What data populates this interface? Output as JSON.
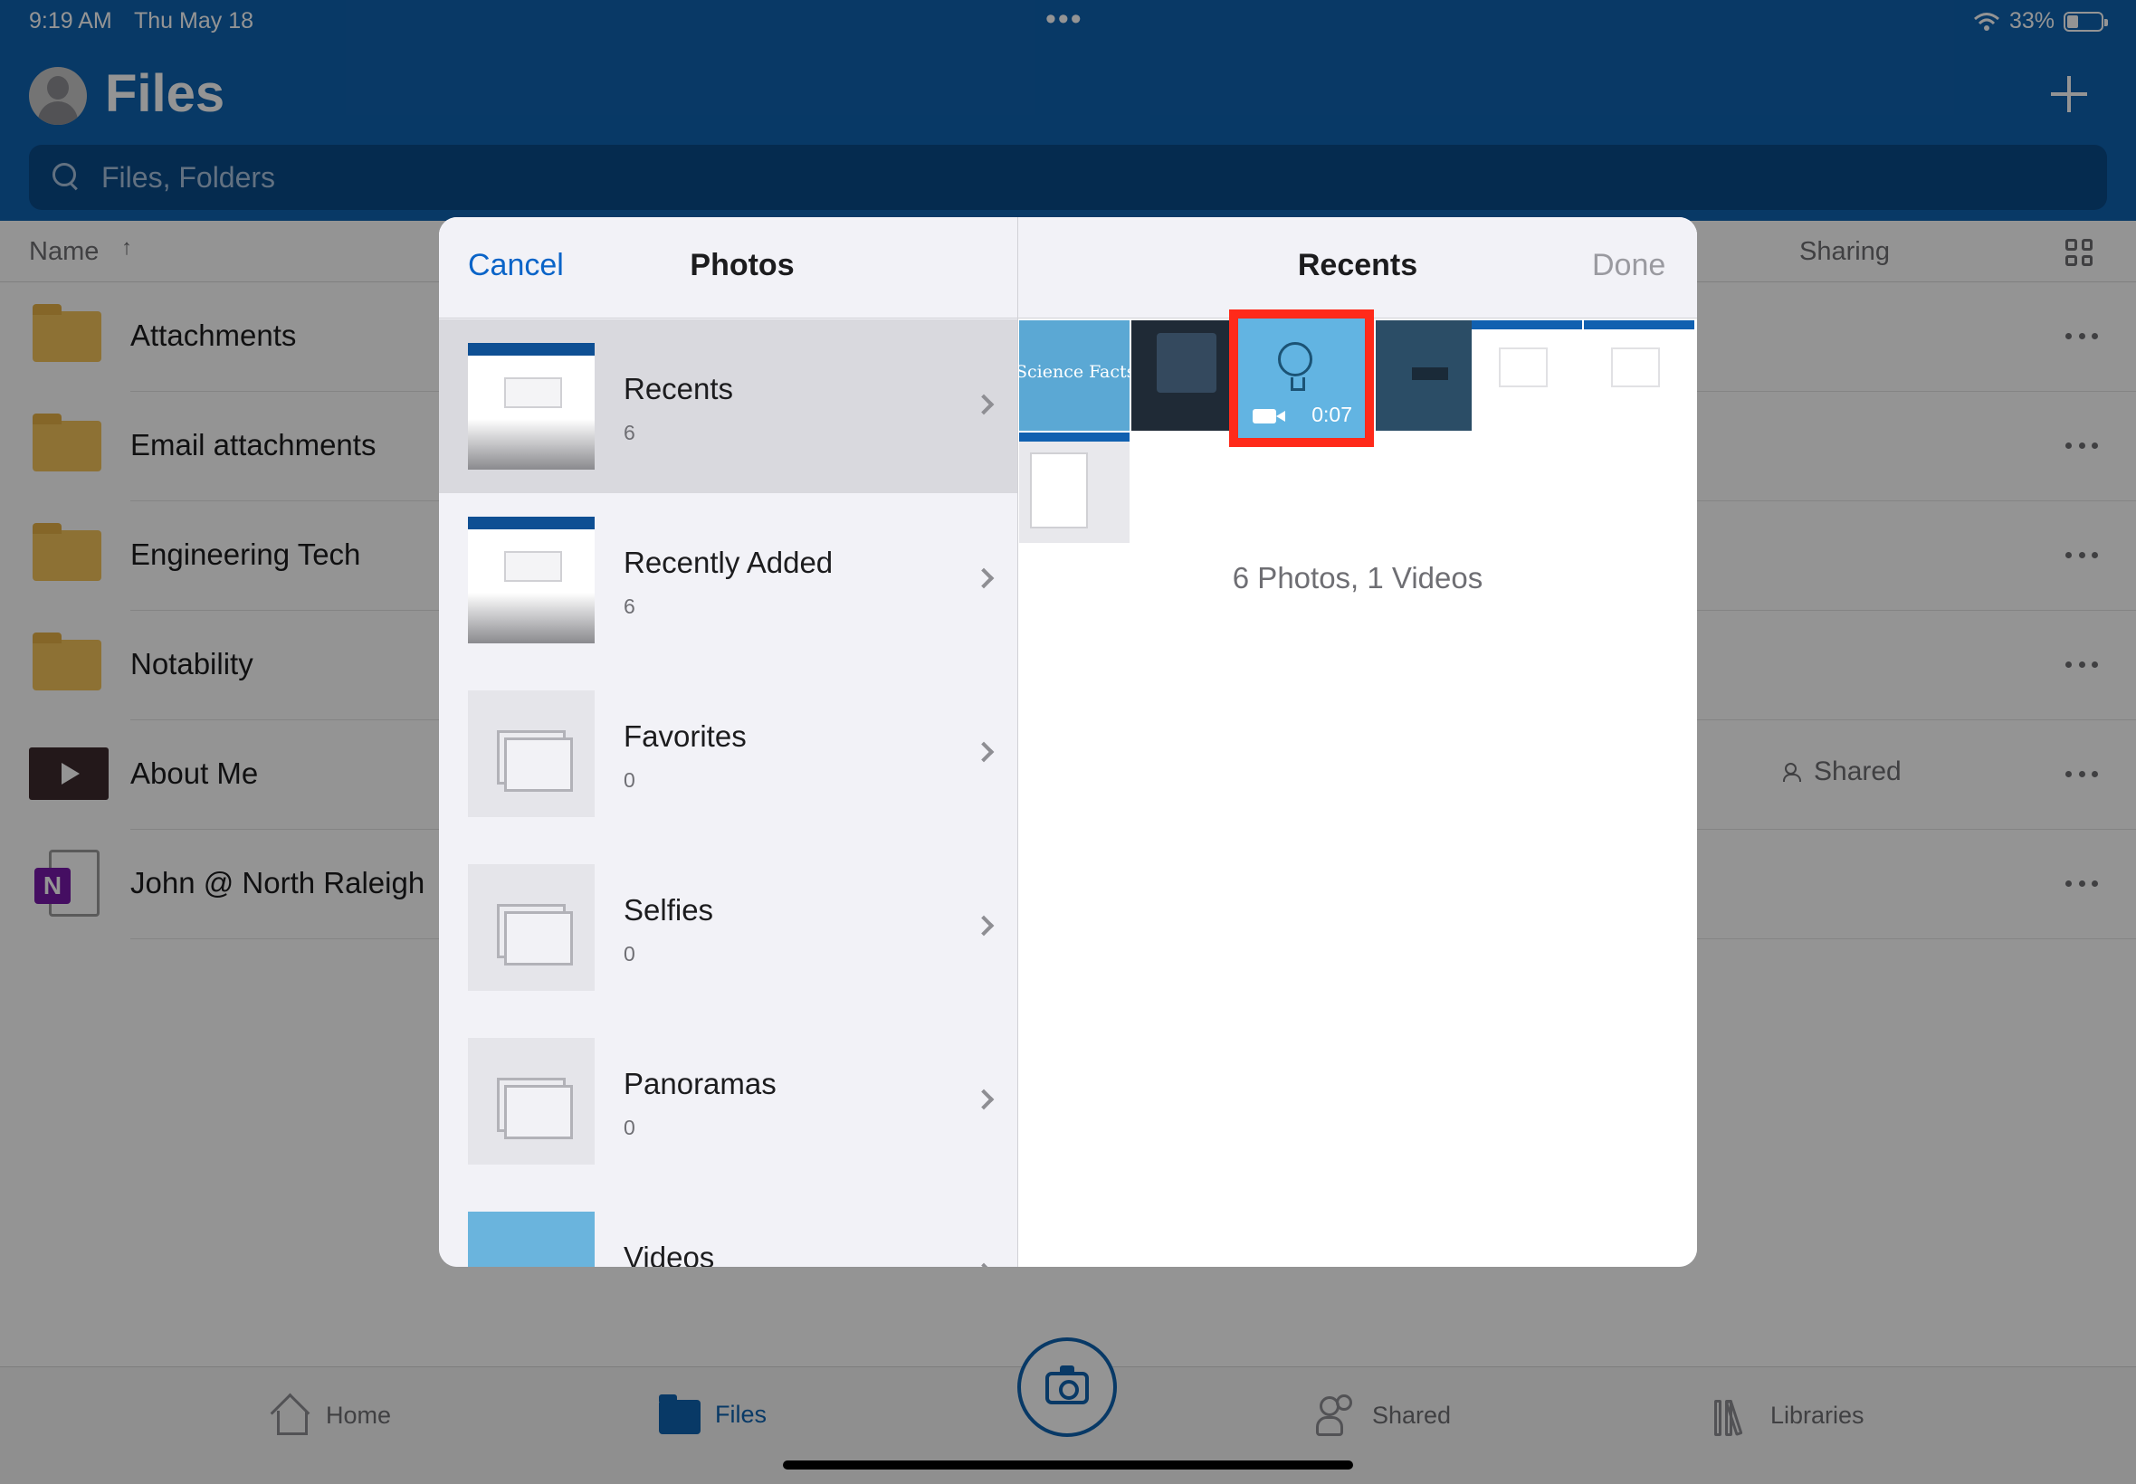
{
  "status": {
    "time": "9:19 AM",
    "date": "Thu May 18",
    "battery": "33%"
  },
  "app": {
    "title": "Files"
  },
  "search": {
    "placeholder": "Files, Folders"
  },
  "columns": {
    "name": "Name",
    "sort_arrow": "↑",
    "sharing": "Sharing"
  },
  "files": [
    {
      "name": "Attachments",
      "type": "folder",
      "sharing": ""
    },
    {
      "name": "Email attachments",
      "type": "folder",
      "sharing": ""
    },
    {
      "name": "Engineering Tech",
      "type": "folder",
      "sharing": ""
    },
    {
      "name": "Notability",
      "type": "folder",
      "sharing": ""
    },
    {
      "name": "About Me",
      "type": "video",
      "sharing": "Shared"
    },
    {
      "name": "John @ North Raleigh",
      "type": "onenote",
      "sharing": ""
    }
  ],
  "tabs": [
    {
      "label": "Home",
      "icon": "home-icon"
    },
    {
      "label": "Files",
      "icon": "folder-icon",
      "active": true
    },
    {
      "label": "Shared",
      "icon": "people-icon"
    },
    {
      "label": "Libraries",
      "icon": "libraries-icon"
    }
  ],
  "picker": {
    "cancel_label": "Cancel",
    "sidebar_title": "Photos",
    "content_title": "Recents",
    "done_label": "Done",
    "albums": [
      {
        "name": "Recents",
        "count": "6",
        "selected": true
      },
      {
        "name": "Recently Added",
        "count": "6"
      },
      {
        "name": "Favorites",
        "count": "0"
      },
      {
        "name": "Selfies",
        "count": "0"
      },
      {
        "name": "Panoramas",
        "count": "0"
      },
      {
        "name": "Videos",
        "count": ""
      }
    ],
    "photo_caption": "Science Facts",
    "video_duration": "0:07",
    "summary": "6 Photos, 1 Videos"
  },
  "colors": {
    "header_blue": "#0f62b0",
    "accent_blue": "#0a64c8",
    "highlight_red": "#ff2a1a",
    "folder_yellow": "#f3c35a",
    "onenote_purple": "#7719aa"
  }
}
